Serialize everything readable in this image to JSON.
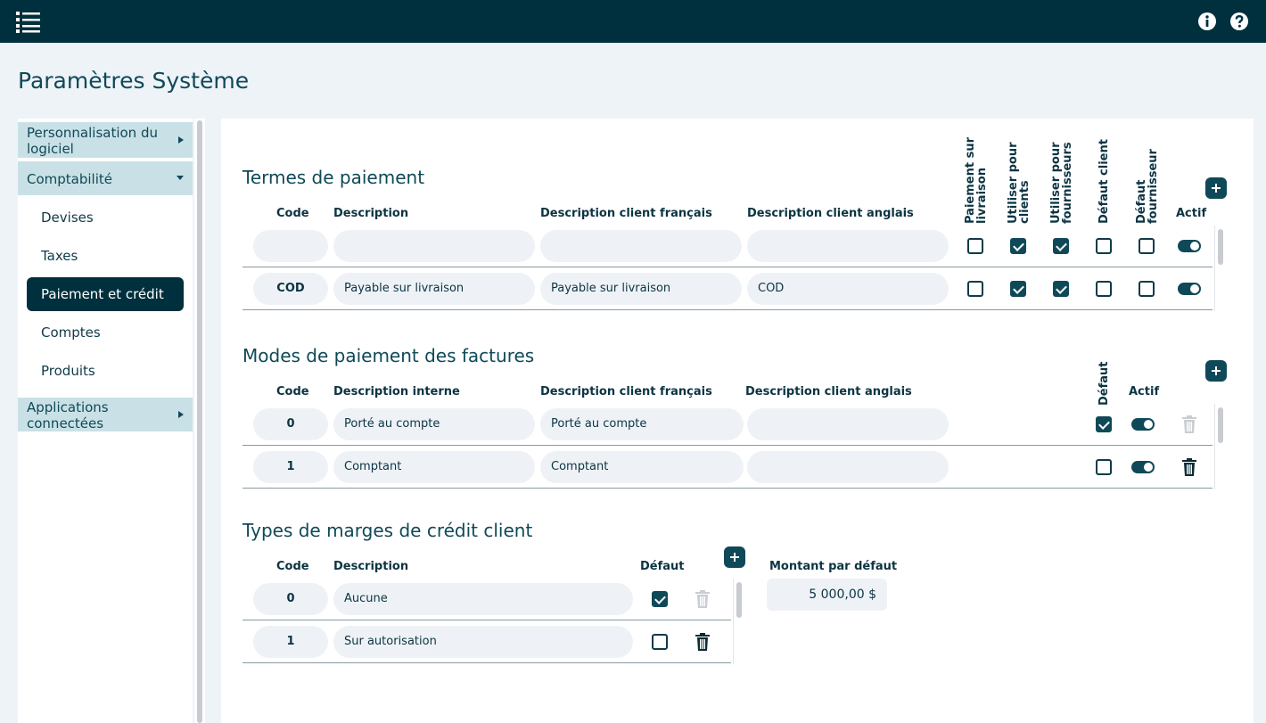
{
  "page": {
    "title": "Paramètres Système"
  },
  "topbar": {
    "menu_icon": "list-icon",
    "info_icon": "info-icon",
    "help_icon": "help-icon"
  },
  "sidebar": {
    "groups": [
      {
        "label": "Personnalisation du logiciel",
        "expanded": false
      },
      {
        "label": "Comptabilité",
        "expanded": true
      },
      {
        "label": "Applications connectées",
        "expanded": false
      }
    ],
    "items": [
      "Devises",
      "Taxes",
      "Paiement et crédit",
      "Comptes",
      "Produits"
    ],
    "active_item": "Paiement et crédit"
  },
  "payment_terms": {
    "title": "Termes de paiement",
    "headers": {
      "code": "Code",
      "description": "Description",
      "desc_fr": "Description client français",
      "desc_en": "Description client anglais",
      "cod": "Paiement sur livraison",
      "use_clients": "Utiliser pour clients",
      "use_suppliers": "Utiliser pour fournisseurs",
      "default_client": "Défaut client",
      "default_supplier": "Défaut fournisseur",
      "active": "Actif"
    },
    "rows": [
      {
        "code": "",
        "description": "",
        "desc_fr": "",
        "desc_en": "",
        "cod": false,
        "use_clients": true,
        "use_suppliers": true,
        "default_client": false,
        "default_supplier": false,
        "active": true
      },
      {
        "code": "COD",
        "description": "Payable sur livraison",
        "desc_fr": "Payable sur livraison",
        "desc_en": "COD",
        "cod": false,
        "use_clients": true,
        "use_suppliers": true,
        "default_client": false,
        "default_supplier": false,
        "active": true
      }
    ]
  },
  "invoice_modes": {
    "title": "Modes de paiement des factures",
    "headers": {
      "code": "Code",
      "internal": "Description interne",
      "desc_fr": "Description client français",
      "desc_en": "Description client anglais",
      "default": "Défaut",
      "active": "Actif"
    },
    "rows": [
      {
        "code": "0",
        "internal": "Porté au compte",
        "desc_fr": "Porté au compte",
        "desc_en": "",
        "default": true,
        "active": true,
        "deletable": false
      },
      {
        "code": "1",
        "internal": "Comptant",
        "desc_fr": "Comptant",
        "desc_en": "",
        "default": false,
        "active": true,
        "deletable": true
      }
    ]
  },
  "credit_margins": {
    "title": "Types de marges de crédit client",
    "headers": {
      "code": "Code",
      "description": "Description",
      "default": "Défaut"
    },
    "rows": [
      {
        "code": "0",
        "description": "Aucune",
        "default": true,
        "deletable": false
      },
      {
        "code": "1",
        "description": "Sur autorisation",
        "default": false,
        "deletable": true
      }
    ],
    "default_amount_label": "Montant par défaut",
    "default_amount": "5 000,00 $"
  },
  "colors": {
    "topbar": "#00303d",
    "accent": "#0f4958",
    "group_bg": "#c9e1e6",
    "page_bg": "#eef3f8"
  }
}
